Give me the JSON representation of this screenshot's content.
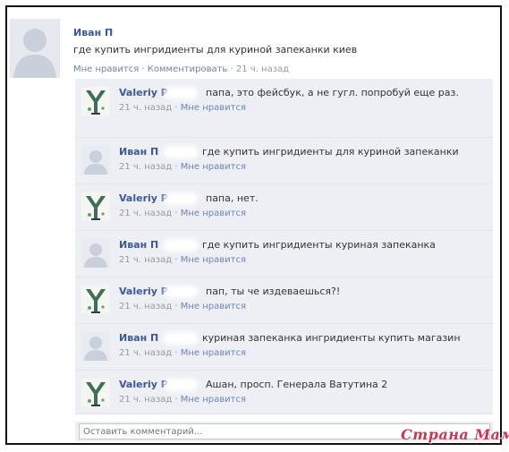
{
  "post": {
    "author": "Иван П",
    "text": "где купить ингридиенты для куриной запеканки киев",
    "like_label": "Мне нравится",
    "separator": " · ",
    "comment_label": "Комментировать",
    "time": "21 ч. назад"
  },
  "comments": [
    {
      "author": "Valeriy P",
      "text": "папа, это фейсбук, а не гугл. попробуй еще раз.",
      "time": "21 ч. назад",
      "like_label": "Мне нравится",
      "avatar": "valeriy-logo"
    },
    {
      "author": "Иван П",
      "text": "где купить ингридиенты для куриной запеканки",
      "time": "21 ч. назад",
      "like_label": "Мне нравится",
      "avatar": "default-user"
    },
    {
      "author": "Valeriy P",
      "text": "папа, нет.",
      "time": "21 ч. назад",
      "like_label": "Мне нравится",
      "avatar": "valeriy-logo"
    },
    {
      "author": "Иван П",
      "text": "где купить ингридиенты куриная запеканка",
      "time": "21 ч. назад",
      "like_label": "Мне нравится",
      "avatar": "default-user"
    },
    {
      "author": "Valeriy P",
      "text": "пап, ты че издеваешься?!",
      "time": "21 ч. назад",
      "like_label": "Мне нравится",
      "avatar": "valeriy-logo"
    },
    {
      "author": "Иван П",
      "text": "куриная запеканка ингридиенты купить магазин",
      "time": "21 ч. назад",
      "like_label": "Мне нравится",
      "avatar": "default-user"
    },
    {
      "author": "Valeriy P",
      "text": "Ашан, просп. Генерала Ватутина 2",
      "time": "21 ч. назад",
      "like_label": "Мне нравится",
      "avatar": "valeriy-logo"
    }
  ],
  "comment_box": {
    "placeholder": "Оставить комментарий..."
  },
  "watermark": "Страна Мам",
  "colors": {
    "link": "#3b5998",
    "meta_link": "#6d84b4",
    "comment_bg": "#edeff4",
    "watermark": "#c33a55"
  }
}
